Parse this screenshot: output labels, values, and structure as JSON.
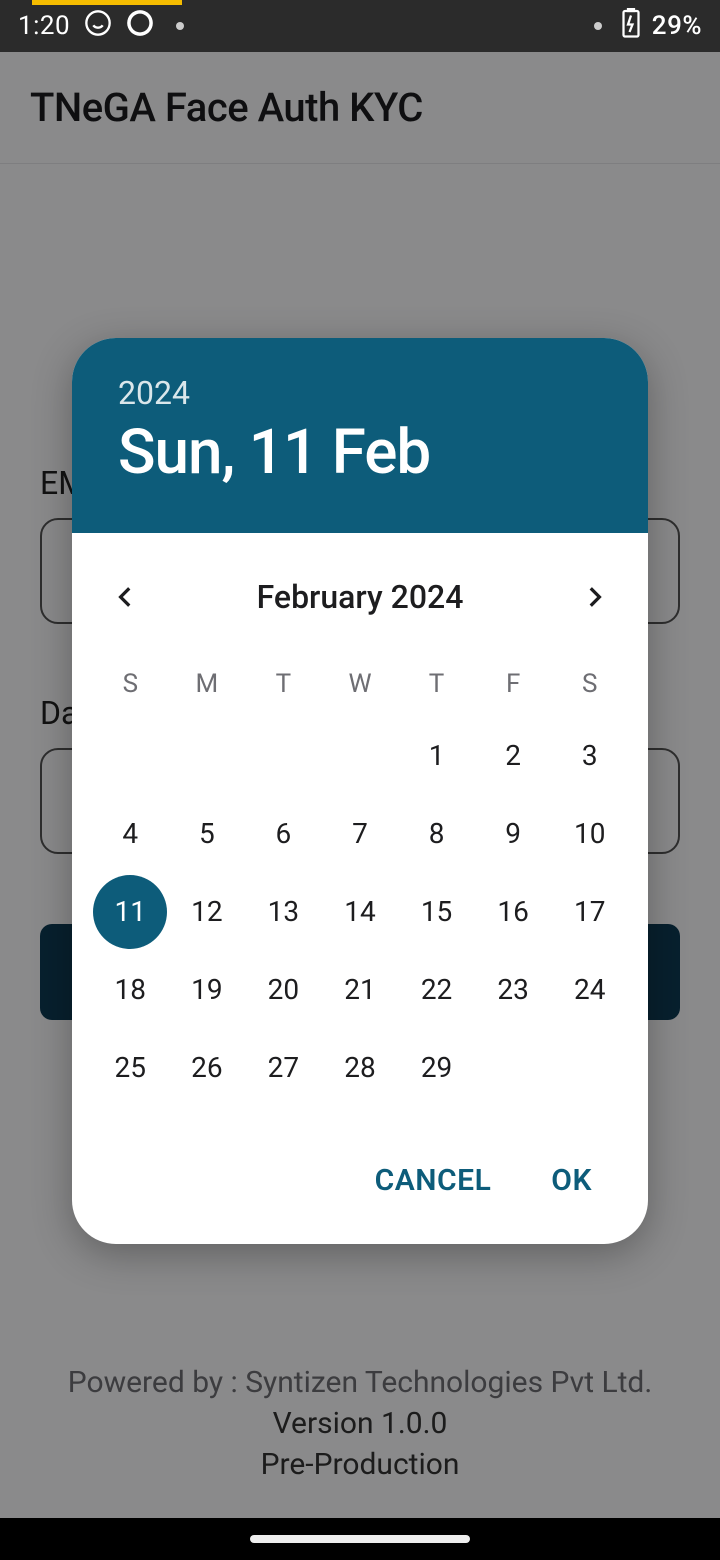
{
  "status": {
    "time": "1:20",
    "battery_pct": "29%"
  },
  "app": {
    "title": "TNeGA Face Auth KYC",
    "field1_label": "EM",
    "field2_label": "Da"
  },
  "footer": {
    "powered": "Powered by : Syntizen Technologies Pvt Ltd.",
    "version": "Version 1.0.0",
    "env": "Pre-Production"
  },
  "datepicker": {
    "year": "2024",
    "date_display": "Sun, 11 Feb",
    "month_label": "February 2024",
    "dow": [
      "S",
      "M",
      "T",
      "W",
      "T",
      "F",
      "S"
    ],
    "weeks": [
      [
        "",
        "",
        "",
        "",
        "1",
        "2",
        "3"
      ],
      [
        "4",
        "5",
        "6",
        "7",
        "8",
        "9",
        "10"
      ],
      [
        "11",
        "12",
        "13",
        "14",
        "15",
        "16",
        "17"
      ],
      [
        "18",
        "19",
        "20",
        "21",
        "22",
        "23",
        "24"
      ],
      [
        "25",
        "26",
        "27",
        "28",
        "29",
        "",
        ""
      ]
    ],
    "selected": "11",
    "actions": {
      "cancel": "CANCEL",
      "ok": "OK"
    }
  }
}
